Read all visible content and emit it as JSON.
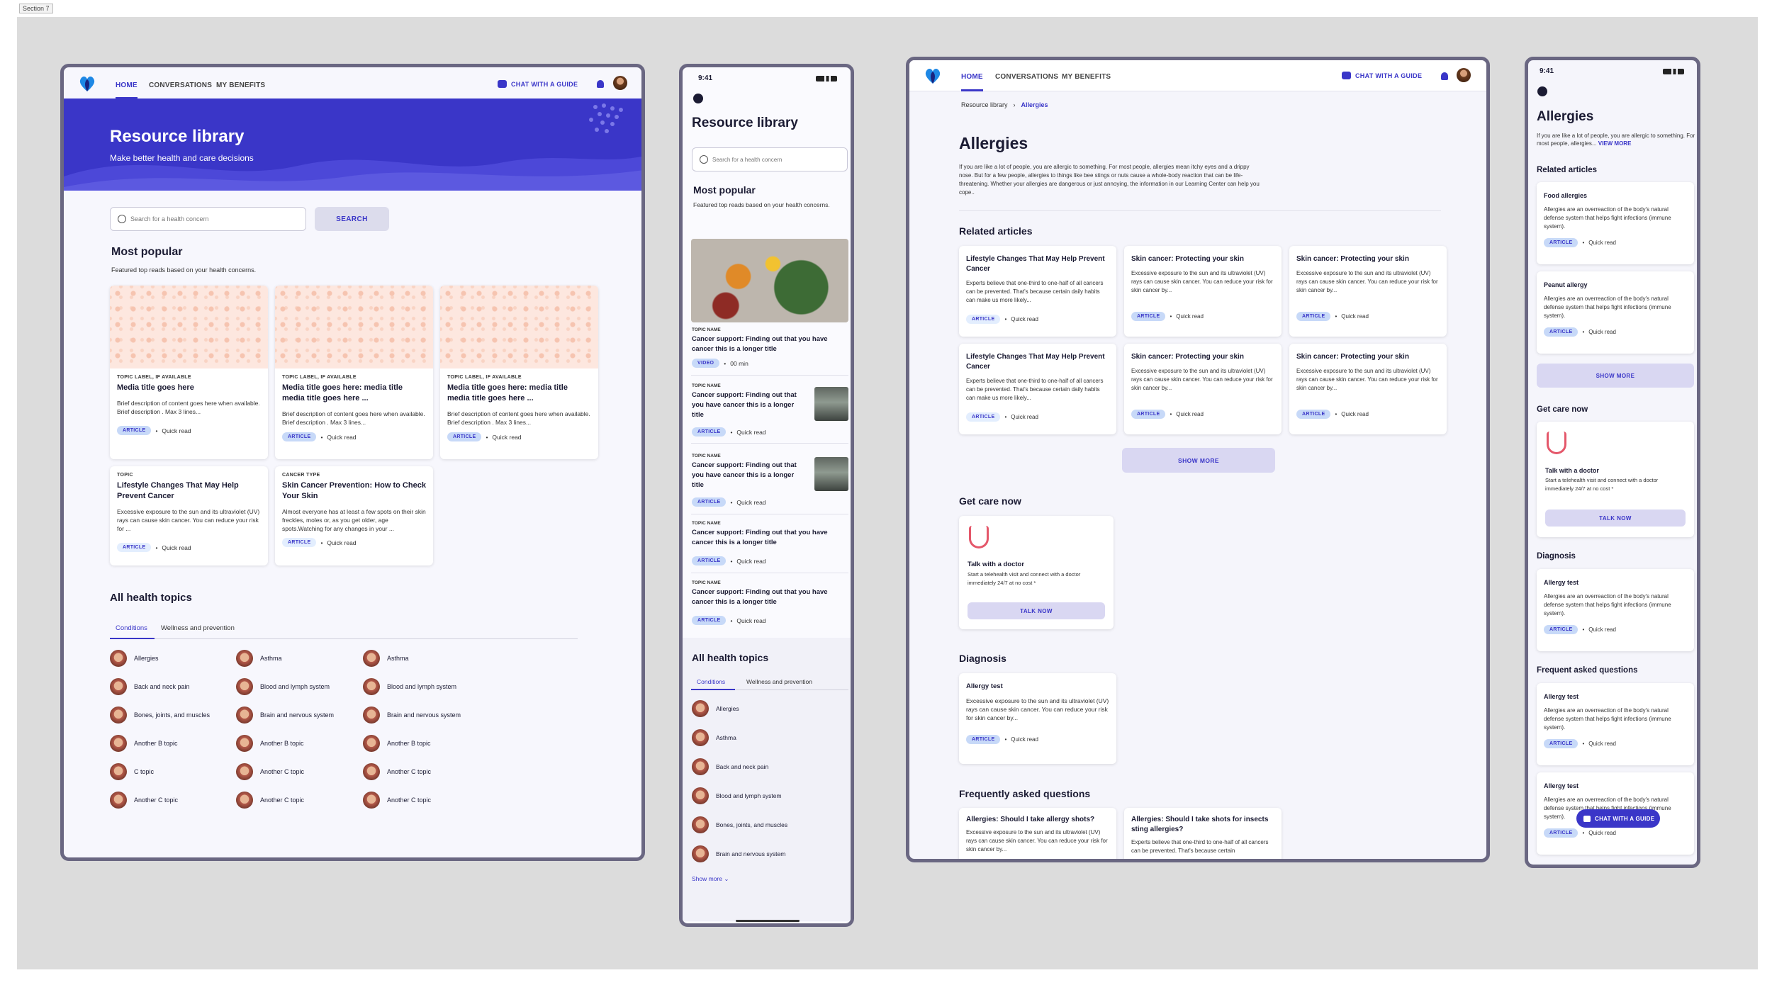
{
  "section_label": "Section 7",
  "colors": {
    "brand": "#3a36c8",
    "hero": "#3a36c8",
    "badge": "#c7d9f8",
    "frame": "#6a6782"
  },
  "nav": {
    "home": "HOME",
    "conversations": "CONVERSATIONS",
    "benefits": "MY BENEFITS",
    "chat": "CHAT WITH A GUIDE"
  },
  "library": {
    "title": "Resource library",
    "subtitle": "Make better health and care decisions",
    "search_placeholder": "Search for a health concern",
    "search_button": "SEARCH",
    "popular_title": "Most popular",
    "popular_sub": "Featured top reads based on your health concerns.",
    "cards": [
      {
        "label": "TOPIC LABEL, IF AVAILABLE",
        "title": "Media title goes here",
        "desc": "Brief description of content goes here when available. Brief description . Max 3 lines...",
        "badge": "ARTICLE",
        "meta": "Quick read"
      },
      {
        "label": "TOPIC LABEL, IF AVAILABLE",
        "title": "Media title goes here: media title media title goes here ...",
        "desc": "Brief description of content goes here when available. Brief description . Max 3 lines...",
        "badge": "ARTICLE",
        "meta": "Quick read"
      },
      {
        "label": "TOPIC LABEL, IF AVAILABLE",
        "title": "Media title goes here: media title media title goes here ...",
        "desc": "Brief description of content goes here when available. Brief description . Max 3 lines...",
        "badge": "ARTICLE",
        "meta": "Quick read"
      },
      {
        "label": "TOPIC",
        "title": "Lifestyle Changes That May Help Prevent Cancer",
        "desc": "Excessive exposure to the sun and its ultraviolet (UV) rays can cause skin cancer. You can reduce your risk for ...",
        "badge": "ARTICLE",
        "meta": "Quick read"
      },
      {
        "label": "CANCER TYPE",
        "title": "Skin Cancer Prevention: How to Check Your Skin",
        "desc": "Almost everyone has at least a few spots on their skin freckles, moles or, as you get older, age spots.Watching for any changes in your ...",
        "badge": "ARTICLE",
        "meta": "Quick read"
      }
    ],
    "topics_title": "All health topics",
    "tabs": [
      "Conditions",
      "Wellness and prevention"
    ],
    "topics": [
      "Allergies",
      "Asthma",
      "Asthma",
      "Back and neck pain",
      "Blood and lymph system",
      "Blood and lymph system",
      "Bones, joints, and muscles",
      "Brain and nervous system",
      "Brain and nervous system",
      "Another B topic",
      "Another B topic",
      "Another B topic",
      "C topic",
      "Another C topic",
      "Another C topic",
      "Another C topic",
      "Another C topic",
      "Another C topic"
    ]
  },
  "mobile_library": {
    "time": "9:41",
    "title": "Resource library",
    "search_placeholder": "Search for a health concern",
    "popular_title": "Most popular",
    "popular_sub": "Featured top reads based on your health concerns.",
    "hero": {
      "label": "TOPIC NAME",
      "title": "Cancer support: Finding out that you have cancer this is a longer title",
      "badge": "VIDEO",
      "meta": "00 min"
    },
    "items": [
      {
        "label": "TOPIC NAME",
        "title": "Cancer support: Finding out that you have cancer this is a longer title",
        "badge": "ARTICLE",
        "meta": "Quick read"
      },
      {
        "label": "TOPIC NAME",
        "title": "Cancer support: Finding out that you have cancer this is a longer title",
        "badge": "ARTICLE",
        "meta": "Quick read"
      },
      {
        "label": "TOPIC NAME",
        "title": "Cancer support: Finding out that you have cancer this is a longer title",
        "badge": "ARTICLE",
        "meta": "Quick read"
      },
      {
        "label": "TOPIC NAME",
        "title": "Cancer support: Finding out that you have cancer this is a longer title",
        "badge": "ARTICLE",
        "meta": "Quick read"
      }
    ],
    "topics_title": "All health topics",
    "tabs": [
      "Conditions",
      "Wellness and prevention"
    ],
    "topics": [
      "Allergies",
      "Asthma",
      "Back and neck pain",
      "Blood and lymph system",
      "Bones, joints, and muscles",
      "Brain and nervous system"
    ],
    "show_more": "Show more"
  },
  "allergies": {
    "breadcrumb": [
      "Resource library",
      "Allergies"
    ],
    "title": "Allergies",
    "intro": "If you are like a lot of people, you are allergic to something. For most people, allergies mean itchy eyes and a drippy nose. But for a few people, allergies to things like bee stings or nuts cause a whole-body reaction that can be life-threatening. Whether your allergies are dangerous or just annoying, the information in our Learning Center can help you cope..",
    "related_title": "Related articles",
    "related": [
      {
        "title": "Lifestyle Changes That May Help Prevent Cancer",
        "desc": "Experts believe that one-third to one-half of all cancers can be prevented. That's because certain daily habits can make us more likely...",
        "badge": "ARTICLE",
        "meta": "Quick read",
        "outline": true
      },
      {
        "title": "Skin cancer: Protecting your skin",
        "desc": "Excessive exposure to the sun and its ultraviolet (UV) rays can cause skin cancer. You can reduce your risk for skin cancer by...",
        "badge": "ARTICLE",
        "meta": "Quick read",
        "outline": false
      },
      {
        "title": "Skin cancer: Protecting your skin",
        "desc": "Excessive exposure to the sun and its ultraviolet (UV) rays can cause skin cancer. You can reduce your risk for skin cancer by...",
        "badge": "ARTICLE",
        "meta": "Quick read",
        "outline": false
      },
      {
        "title": "Lifestyle Changes That May Help Prevent Cancer",
        "desc": "Experts believe that one-third to one-half of all cancers can be prevented. That's because certain daily habits can make us more likely...",
        "badge": "ARTICLE",
        "meta": "Quick read",
        "outline": true
      },
      {
        "title": "Skin cancer: Protecting your skin",
        "desc": "Excessive exposure to the sun and its ultraviolet (UV) rays can cause skin cancer. You can reduce your risk for skin cancer by...",
        "badge": "ARTICLE",
        "meta": "Quick read",
        "outline": false
      },
      {
        "title": "Skin cancer: Protecting your skin",
        "desc": "Excessive exposure to the sun and its ultraviolet (UV) rays can cause skin cancer. You can reduce your risk for skin cancer by...",
        "badge": "ARTICLE",
        "meta": "Quick read",
        "outline": false
      }
    ],
    "show_more": "SHOW MORE",
    "care_title": "Get care now",
    "care": {
      "title": "Talk with a doctor",
      "desc": "Start a telehealth visit and connect with a doctor immediately 24/7 at no cost *",
      "button": "TALK NOW"
    },
    "diagnosis_title": "Diagnosis",
    "diagnosis": {
      "title": "Allergy test",
      "desc": "Excessive exposure to the sun and its ultraviolet (UV) rays can cause skin cancer. You can reduce your risk for skin cancer by...",
      "badge": "ARTICLE",
      "meta": "Quick read"
    },
    "faq_title": "Frequently asked questions",
    "faq": [
      {
        "title": "Allergies: Should I take allergy shots?",
        "desc": "Excessive exposure to the sun and its ultraviolet (UV) rays can cause skin cancer. You can reduce your risk for skin cancer by..."
      },
      {
        "title": "Allergies: Should I take shots for insects sting allergies?",
        "desc": "Experts believe that one-third to one-half of all cancers can be prevented. That's because certain"
      }
    ]
  },
  "mobile_allergies": {
    "time": "9:41",
    "title": "Allergies",
    "intro": "If you are like a lot of people, you are allergic to something. For most people, allergies...",
    "view_more": "VIEW MORE",
    "related_title": "Related articles",
    "related": [
      {
        "title": "Food allergies",
        "desc": "Allergies are an overreaction of the body's natural defense system that helps fight infections (immune system).",
        "badge": "ARTICLE",
        "meta": "Quick read"
      },
      {
        "title": "Peanut allergy",
        "desc": "Allergies are an overreaction of the body's natural defense system that helps fight infections (immune system).",
        "badge": "ARTICLE",
        "meta": "Quick read"
      }
    ],
    "show_more": "SHOW MORE",
    "care_title": "Get care now",
    "care": {
      "title": "Talk with a doctor",
      "desc": "Start a telehealth visit and connect with a doctor immediately 24/7 at no cost *",
      "button": "TALK NOW"
    },
    "diagnosis_title": "Diagnosis",
    "diagnosis": {
      "title": "Allergy test",
      "desc": "Allergies are an overreaction of the body's natural defense system that helps fight infections (immune system).",
      "badge": "ARTICLE",
      "meta": "Quick read"
    },
    "faq_title": "Frequent asked questions",
    "faq": [
      {
        "title": "Allergy test",
        "desc": "Allergies are an overreaction of the body's natural defense system that helps fight infections (immune system).",
        "badge": "ARTICLE",
        "meta": "Quick read"
      },
      {
        "title": "Allergy test",
        "desc": "Allergies are an overreaction of the body's natural defense system that helps fight infections (immune system).",
        "badge": "ARTICLE",
        "meta": "Quick read"
      }
    ],
    "chat": "CHAT WITH A GUIDE"
  }
}
